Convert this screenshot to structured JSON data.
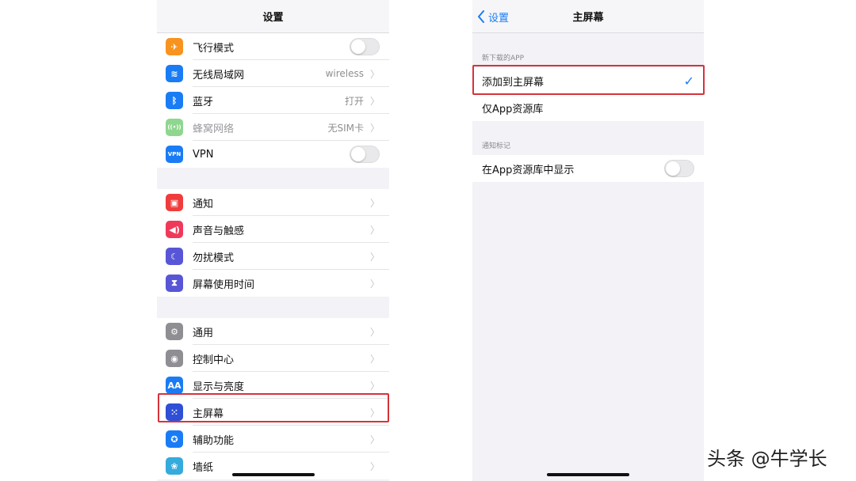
{
  "left_screen": {
    "title": "设置",
    "group1": [
      {
        "label": "飞行模式",
        "icon": "airplane-icon",
        "color": "#f7931e",
        "glyph": "✈",
        "toggle": true
      },
      {
        "label": "无线局域网",
        "icon": "wifi-icon",
        "color": "#1a7cf5",
        "glyph": "≋",
        "value": "wireless",
        "chevron": true
      },
      {
        "label": "蓝牙",
        "icon": "bluetooth-icon",
        "color": "#1a7cf5",
        "glyph": "ᛒ",
        "value": "打开",
        "chevron": true
      },
      {
        "label": "蜂窝网络",
        "icon": "cellular-icon",
        "color": "#8fd68f",
        "glyph": "((•))",
        "value": "无SIM卡",
        "chevron": true,
        "dim": true
      },
      {
        "label": "VPN",
        "icon": "vpn-icon",
        "color": "#1a7cf5",
        "glyph": "VPN",
        "toggle": true
      }
    ],
    "group2": [
      {
        "label": "通知",
        "icon": "notification-icon",
        "color": "#f03c3c",
        "glyph": "▣"
      },
      {
        "label": "声音与触感",
        "icon": "sound-icon",
        "color": "#f0395a",
        "glyph": "◀)"
      },
      {
        "label": "勿扰模式",
        "icon": "moon-icon",
        "color": "#5856d6",
        "glyph": "☾"
      },
      {
        "label": "屏幕使用时间",
        "icon": "hourglass-icon",
        "color": "#5856d6",
        "glyph": "⧗"
      }
    ],
    "group3": [
      {
        "label": "通用",
        "icon": "gear-icon",
        "color": "#8e8e93",
        "glyph": "⚙"
      },
      {
        "label": "控制中心",
        "icon": "control-center-icon",
        "color": "#8e8e93",
        "glyph": "◉"
      },
      {
        "label": "显示与亮度",
        "icon": "display-icon",
        "color": "#1a7cf5",
        "glyph": "AA"
      },
      {
        "label": "主屏幕",
        "icon": "home-screen-icon",
        "color": "#2f4fd6",
        "glyph": "⁙"
      },
      {
        "label": "辅助功能",
        "icon": "accessibility-icon",
        "color": "#1a7cf5",
        "glyph": "✪"
      },
      {
        "label": "墙纸",
        "icon": "wallpaper-icon",
        "color": "#35aadc",
        "glyph": "❀"
      }
    ]
  },
  "right_screen": {
    "back_label": "设置",
    "title": "主屏幕",
    "section1_header": "新下载的APP",
    "option_add": "添加到主屏幕",
    "option_library": "仅App资源库",
    "section2_header": "通知标记",
    "badge_row": "在App资源库中显示"
  },
  "watermark": "头条 @牛学长",
  "accent": "#1a7cf5",
  "highlight_color": "#d6323a"
}
